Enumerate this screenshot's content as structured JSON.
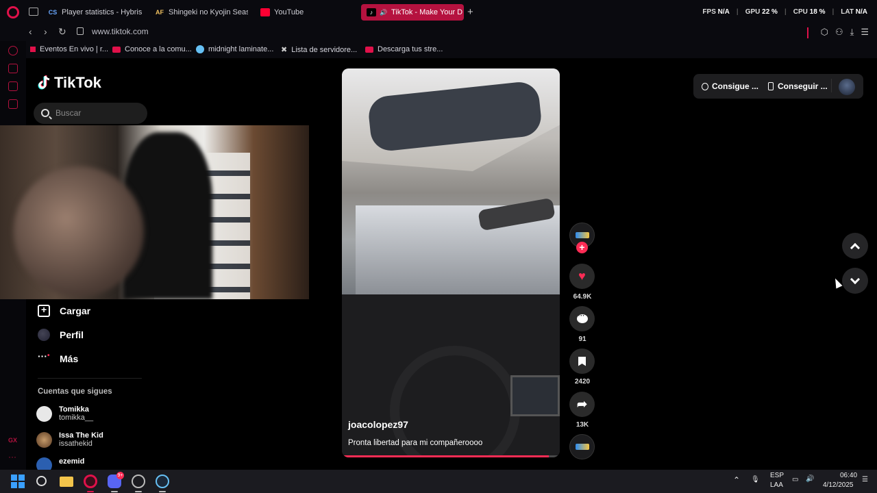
{
  "browser": {
    "tabs": [
      {
        "label": "Player statistics - Hybris",
        "icon": "CS"
      },
      {
        "label": "Shingeki no Kyojin Seaso",
        "icon": "AF"
      },
      {
        "label": "YouTube",
        "icon": "youtube-icon"
      },
      {
        "label": "TikTok - Make Your D",
        "icon": "tiktok-icon",
        "active": true
      }
    ],
    "stats": [
      {
        "label": "FPS",
        "value": "N/A"
      },
      {
        "label": "GPU",
        "value": "22 %"
      },
      {
        "label": "CPU",
        "value": "18 %"
      },
      {
        "label": "LAT",
        "value": "N/A"
      }
    ],
    "url": "www.tiktok.com",
    "bookmarks": [
      "Eventos En vivo | r...",
      "Conoce a la comu...",
      "midnight laminate...",
      "Lista de servidore...",
      "Descarga tus stre..."
    ],
    "sidebar_labels": {
      "gx": "GX",
      "more": "···"
    }
  },
  "tiktok": {
    "logo": "TikTok",
    "search_placeholder": "Buscar",
    "nav": [
      {
        "label": "Cargar",
        "icon": "upload-icon"
      },
      {
        "label": "Perfil",
        "icon": "profile-icon"
      },
      {
        "label": "Más",
        "icon": "more-icon"
      }
    ],
    "following_title": "Cuentas que sigues",
    "following": [
      {
        "name": "Tomikka",
        "handle": "tomikka__"
      },
      {
        "name": "Issa The Kid",
        "handle": "issathekid"
      },
      {
        "name": "ezemid",
        "handle": ""
      }
    ],
    "video": {
      "username": "joacolopez97",
      "description": "Pronta libertad para mi compañeroooo",
      "progress": 0.95
    },
    "actions": {
      "likes": "64.9K",
      "comments": "91",
      "saves": "2420",
      "shares": "13K"
    },
    "top": {
      "get_coins": "Consigue ...",
      "get_app": "Conseguir ..."
    }
  },
  "taskbar": {
    "lang_1": "ESP",
    "lang_2": "LAA",
    "time": "06:40",
    "date": "4/12/2025",
    "discord_badge": "9+"
  },
  "colors": {
    "accent": "#fe2c55",
    "opera": "#e0114a"
  }
}
